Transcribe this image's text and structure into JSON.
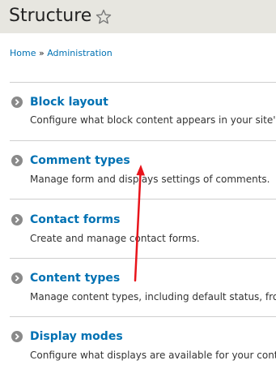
{
  "header": {
    "title": "Structure",
    "star_icon": "star-outline-icon"
  },
  "breadcrumb": {
    "items": [
      "Home",
      "Administration"
    ],
    "separator": "»"
  },
  "items": [
    {
      "label": "Block layout",
      "description": "Configure what block content appears in your site's"
    },
    {
      "label": "Comment types",
      "description": "Manage form and displays settings of comments."
    },
    {
      "label": "Contact forms",
      "description": "Create and manage contact forms."
    },
    {
      "label": "Content types",
      "description": "Manage content types, including default status, from"
    },
    {
      "label": "Display modes",
      "description": "Configure what displays are available for your conte"
    }
  ],
  "colors": {
    "link": "#0071b3",
    "header_bg": "#e7e6e0",
    "annotation": "#e8141b",
    "bullet": "#8a8a8a"
  }
}
